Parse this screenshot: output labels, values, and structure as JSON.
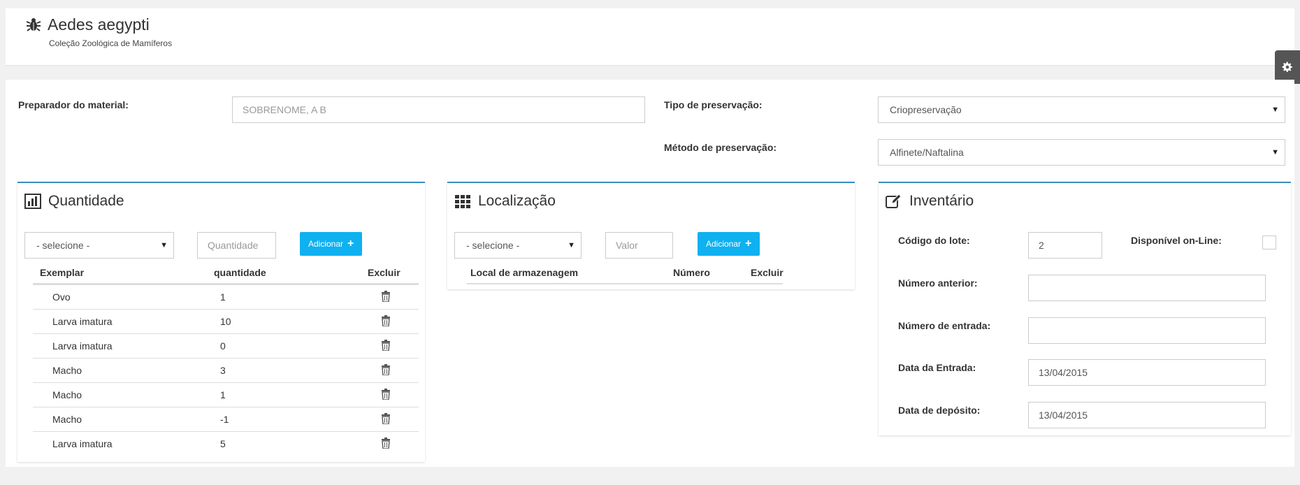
{
  "header": {
    "title": "Aedes aegypti",
    "subtitle": "Coleção Zoológica de Mamíferos",
    "icon": "bug-icon"
  },
  "settings": {
    "icon": "gear-icon"
  },
  "form": {
    "preparador_label": "Preparador do material:",
    "preparador_placeholder": "SOBRENOME, A B",
    "tipo_label": "Tipo de preservação:",
    "tipo_value": "Criopreservação",
    "metodo_label": "Método de preservação:",
    "metodo_value": "Alfinete/Naftalina"
  },
  "quantidade": {
    "title": "Quantidade",
    "icon": "bar-chart-icon",
    "select_value": "- selecione -",
    "qty_placeholder": "Quantidade",
    "add_label": "Adicionar",
    "columns": [
      "Exemplar",
      "quantidade",
      "Excluir"
    ],
    "rows": [
      {
        "exemplar": "Ovo",
        "quantidade": "1"
      },
      {
        "exemplar": "Larva imatura",
        "quantidade": "10"
      },
      {
        "exemplar": "Larva imatura",
        "quantidade": "0"
      },
      {
        "exemplar": "Macho",
        "quantidade": "3"
      },
      {
        "exemplar": "Macho",
        "quantidade": "1"
      },
      {
        "exemplar": "Macho",
        "quantidade": "-1"
      },
      {
        "exemplar": "Larva imatura",
        "quantidade": "5"
      }
    ]
  },
  "localizacao": {
    "title": "Localização",
    "icon": "grid-icon",
    "select_value": "- selecione -",
    "valor_placeholder": "Valor",
    "add_label": "Adicionar",
    "columns": [
      "Local de armazenagem",
      "Número",
      "Excluir"
    ]
  },
  "inventario": {
    "title": "Inventário",
    "icon": "edit-icon",
    "codigo_label": "Código do lote:",
    "codigo_value": "2",
    "online_label": "Disponível on-Line:",
    "numero_anterior_label": "Número anterior:",
    "numero_anterior_value": "",
    "numero_entrada_label": "Número de entrada:",
    "numero_entrada_value": "",
    "data_entrada_label": "Data da Entrada:",
    "data_entrada_value": "13/04/2015",
    "data_deposito_label": "Data de depósito:",
    "data_deposito_value": "13/04/2015"
  },
  "colors": {
    "accent": "#0fb1f0",
    "panel_border": "#3c8dbc",
    "background": "#f1f1f1"
  }
}
